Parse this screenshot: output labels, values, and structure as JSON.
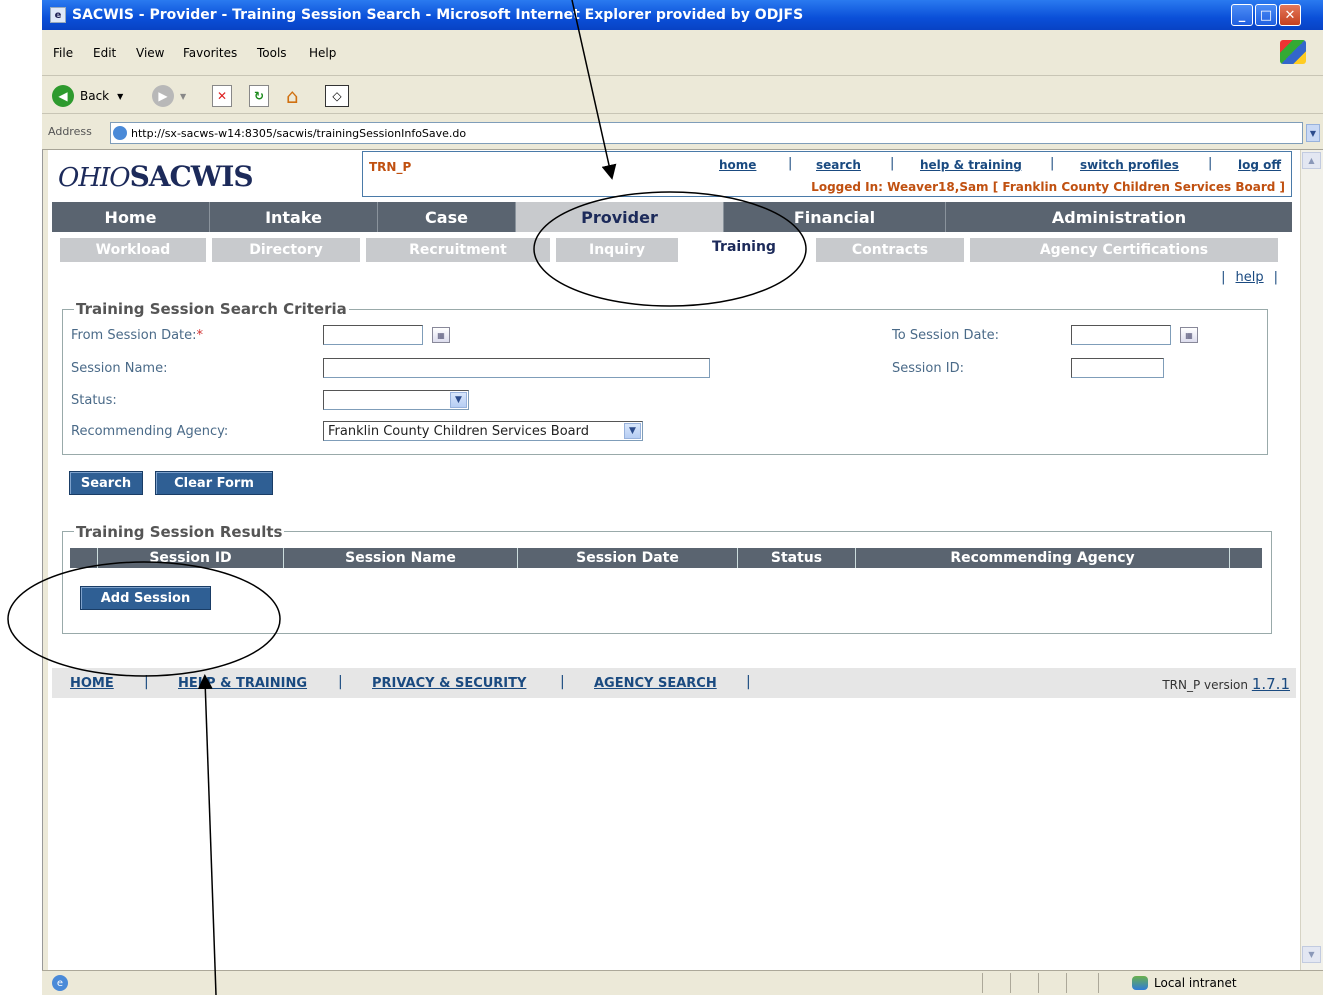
{
  "window": {
    "title": "SACWIS - Provider - Training Session Search - Microsoft Internet Explorer provided by ODJFS"
  },
  "menu": [
    "File",
    "Edit",
    "View",
    "Favorites",
    "Tools",
    "Help"
  ],
  "toolbar": {
    "back_label": "Back"
  },
  "address": {
    "label": "Address",
    "url": "http://sx-sacws-w14:8305/sacwis/trainingSessionInfoSave.do"
  },
  "header": {
    "logo_prefix": "OHIO",
    "logo_main": "SACWIS",
    "screen_code": "TRN_P",
    "links": [
      "home",
      "search",
      "help & training",
      "switch profiles",
      "log off"
    ],
    "logged_in": "Logged In:  Weaver18,Sam [ Franklin County Children Services Board ]"
  },
  "main_tabs": [
    "Home",
    "Intake",
    "Case",
    "Provider",
    "Financial",
    "Administration"
  ],
  "sub_tabs": [
    "Workload",
    "Directory",
    "Recruitment",
    "Inquiry",
    "Training",
    "Contracts",
    "Agency Certifications"
  ],
  "help_link": "help",
  "criteria": {
    "legend": "Training Session Search Criteria",
    "from_label": "From Session Date:",
    "required_mark": "*",
    "to_label": "To Session Date:",
    "name_label": "Session Name:",
    "id_label": "Session ID:",
    "status_label": "Status:",
    "agency_label": "Recommending Agency:",
    "agency_value": "Franklin County Children Services Board"
  },
  "buttons": {
    "search": "Search",
    "clear": "Clear Form",
    "add": "Add Session"
  },
  "results": {
    "legend": "Training Session Results",
    "columns": [
      "Session ID",
      "Session Name",
      "Session Date",
      "Status",
      "Recommending Agency"
    ]
  },
  "footer": {
    "links": [
      "HOME",
      "HELP & TRAINING",
      "PRIVACY & SECURITY",
      "AGENCY SEARCH"
    ],
    "version_label": "TRN_P version",
    "version": "1.7.1"
  },
  "status": {
    "zone": "Local intranet"
  }
}
